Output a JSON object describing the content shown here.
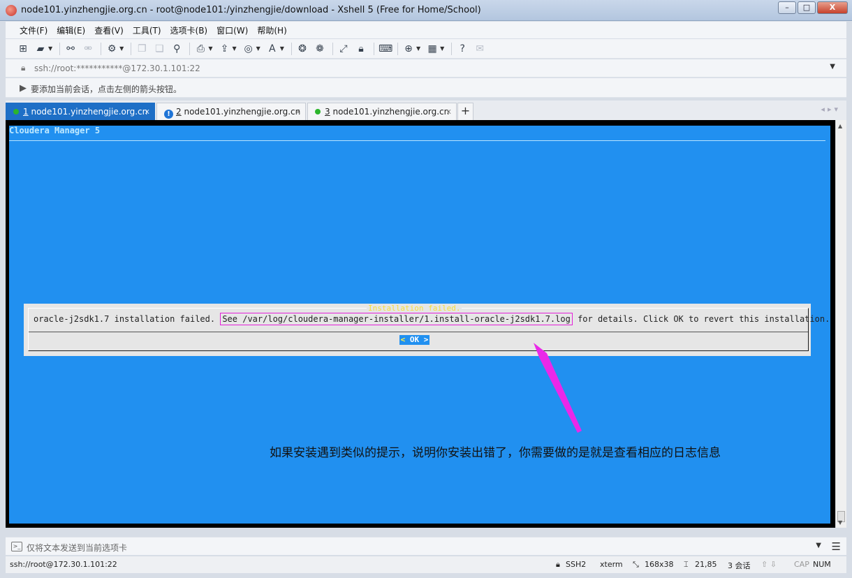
{
  "window": {
    "title": "node101.yinzhengjie.org.cn - root@node101:/yinzhengjie/download - Xshell 5 (Free for Home/School)",
    "buttons": {
      "minimize": "–",
      "maximize": "□",
      "close": "X"
    }
  },
  "menu": [
    "文件(F)",
    "编辑(E)",
    "查看(V)",
    "工具(T)",
    "选项卡(B)",
    "窗口(W)",
    "帮助(H)"
  ],
  "address": {
    "value": "ssh://root:***********@172.30.1.101:22"
  },
  "infobar": {
    "text": "要添加当前会话，点击左侧的箭头按钮。"
  },
  "tabs": [
    {
      "number": "1",
      "label": "node101.yinzhengjie.org.cn",
      "status": "connected",
      "active": true
    },
    {
      "number": "2",
      "label": "node101.yinzhengjie.org.cn",
      "status": "warning",
      "active": false
    },
    {
      "number": "3",
      "label": "node101.yinzhengjie.org.cn",
      "status": "connected",
      "active": false
    }
  ],
  "new_tab_label": "+",
  "terminal": {
    "header": "Cloudera Manager 5",
    "dialog": {
      "title": "Installation failed.",
      "message_before": "oracle-j2sdk1.7 installation failed.",
      "message_highlight": "See /var/log/cloudera-manager-installer/1.install-oracle-j2sdk1.7.log",
      "message_after": "for details. Click OK to revert this installation.",
      "ok_left": "<",
      "ok_label": "OK",
      "ok_right": ">"
    }
  },
  "annotation": {
    "text": "如果安装遇到类似的提示，说明你安装出错了，你需要做的是就是查看相应的日志信息",
    "color": "#ea28e8"
  },
  "input_bar": {
    "placeholder": "仅将文本发送到当前选项卡"
  },
  "status": {
    "connection": "ssh://root@172.30.1.101:22",
    "protocol": "SSH2",
    "terminal_type": "xterm",
    "size": "168x38",
    "cursor": "21,85",
    "sessions": "3 会话",
    "caps": "CAP",
    "num": "NUM"
  },
  "colors": {
    "terminal_bg": "#2190f0",
    "active_tab": "#1e6fc6",
    "dialog_title": "#f6de3a"
  }
}
